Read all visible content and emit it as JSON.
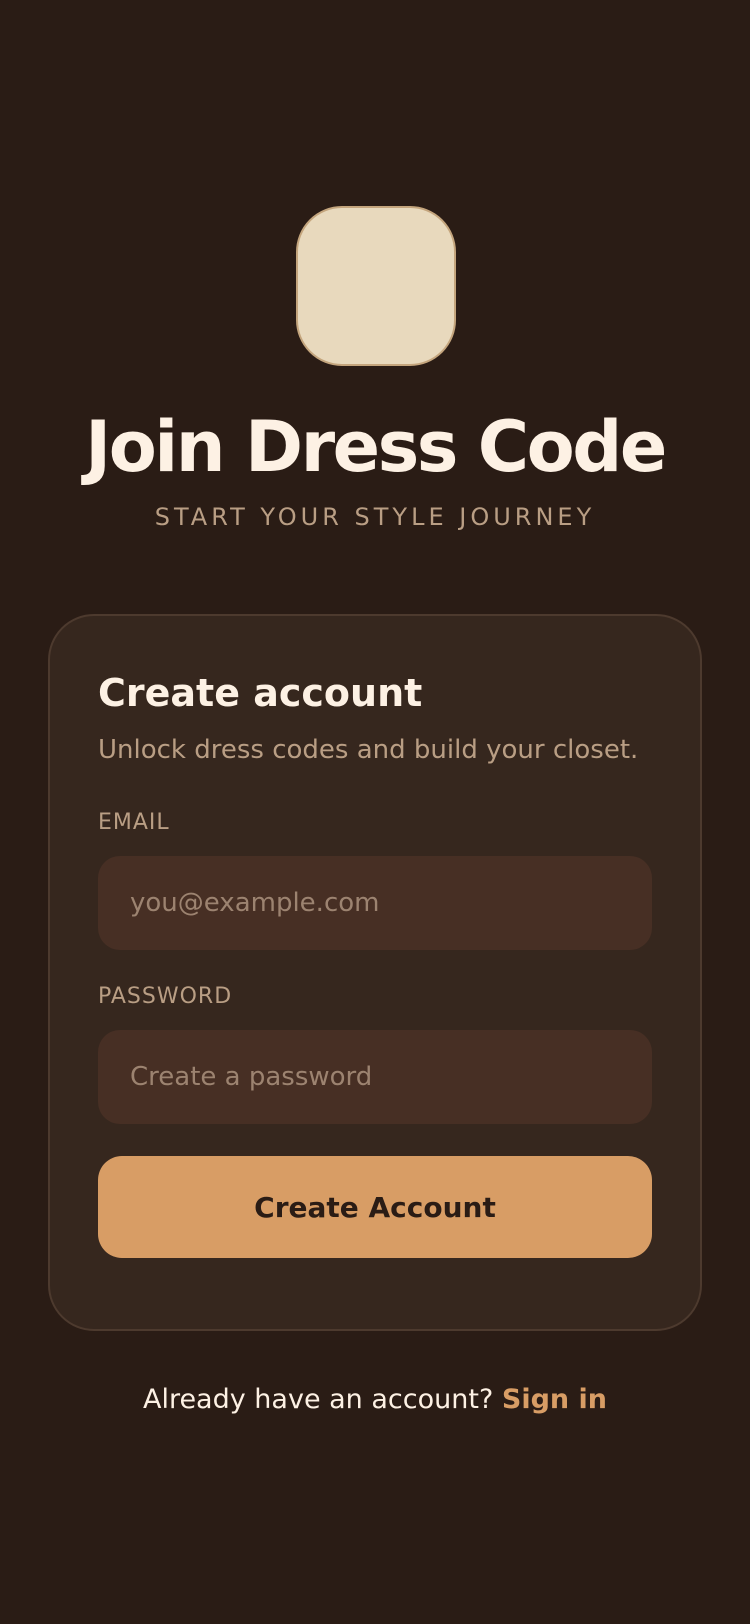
{
  "brand": {
    "logo_icon": "app-logo-icon",
    "title": "Join Dress Code",
    "tagline": "START YOUR STYLE JOURNEY"
  },
  "card": {
    "title": "Create account",
    "subtitle": "Unlock dress codes and build your closet.",
    "email": {
      "label": "EMAIL",
      "value": "",
      "placeholder": "you@example.com"
    },
    "password": {
      "label": "PASSWORD",
      "value": "",
      "placeholder": "Create a password"
    },
    "submit_label": "Create Account"
  },
  "footer": {
    "prompt": "Already have an account?",
    "link_label": "Sign in"
  },
  "colors": {
    "background": "#2a1c15",
    "card": "#36271e",
    "input": "#472f24",
    "accent": "#d89d65",
    "logo": "#e8d9bd",
    "text_primary": "#fdf1e4",
    "text_muted": "#b99e84"
  }
}
